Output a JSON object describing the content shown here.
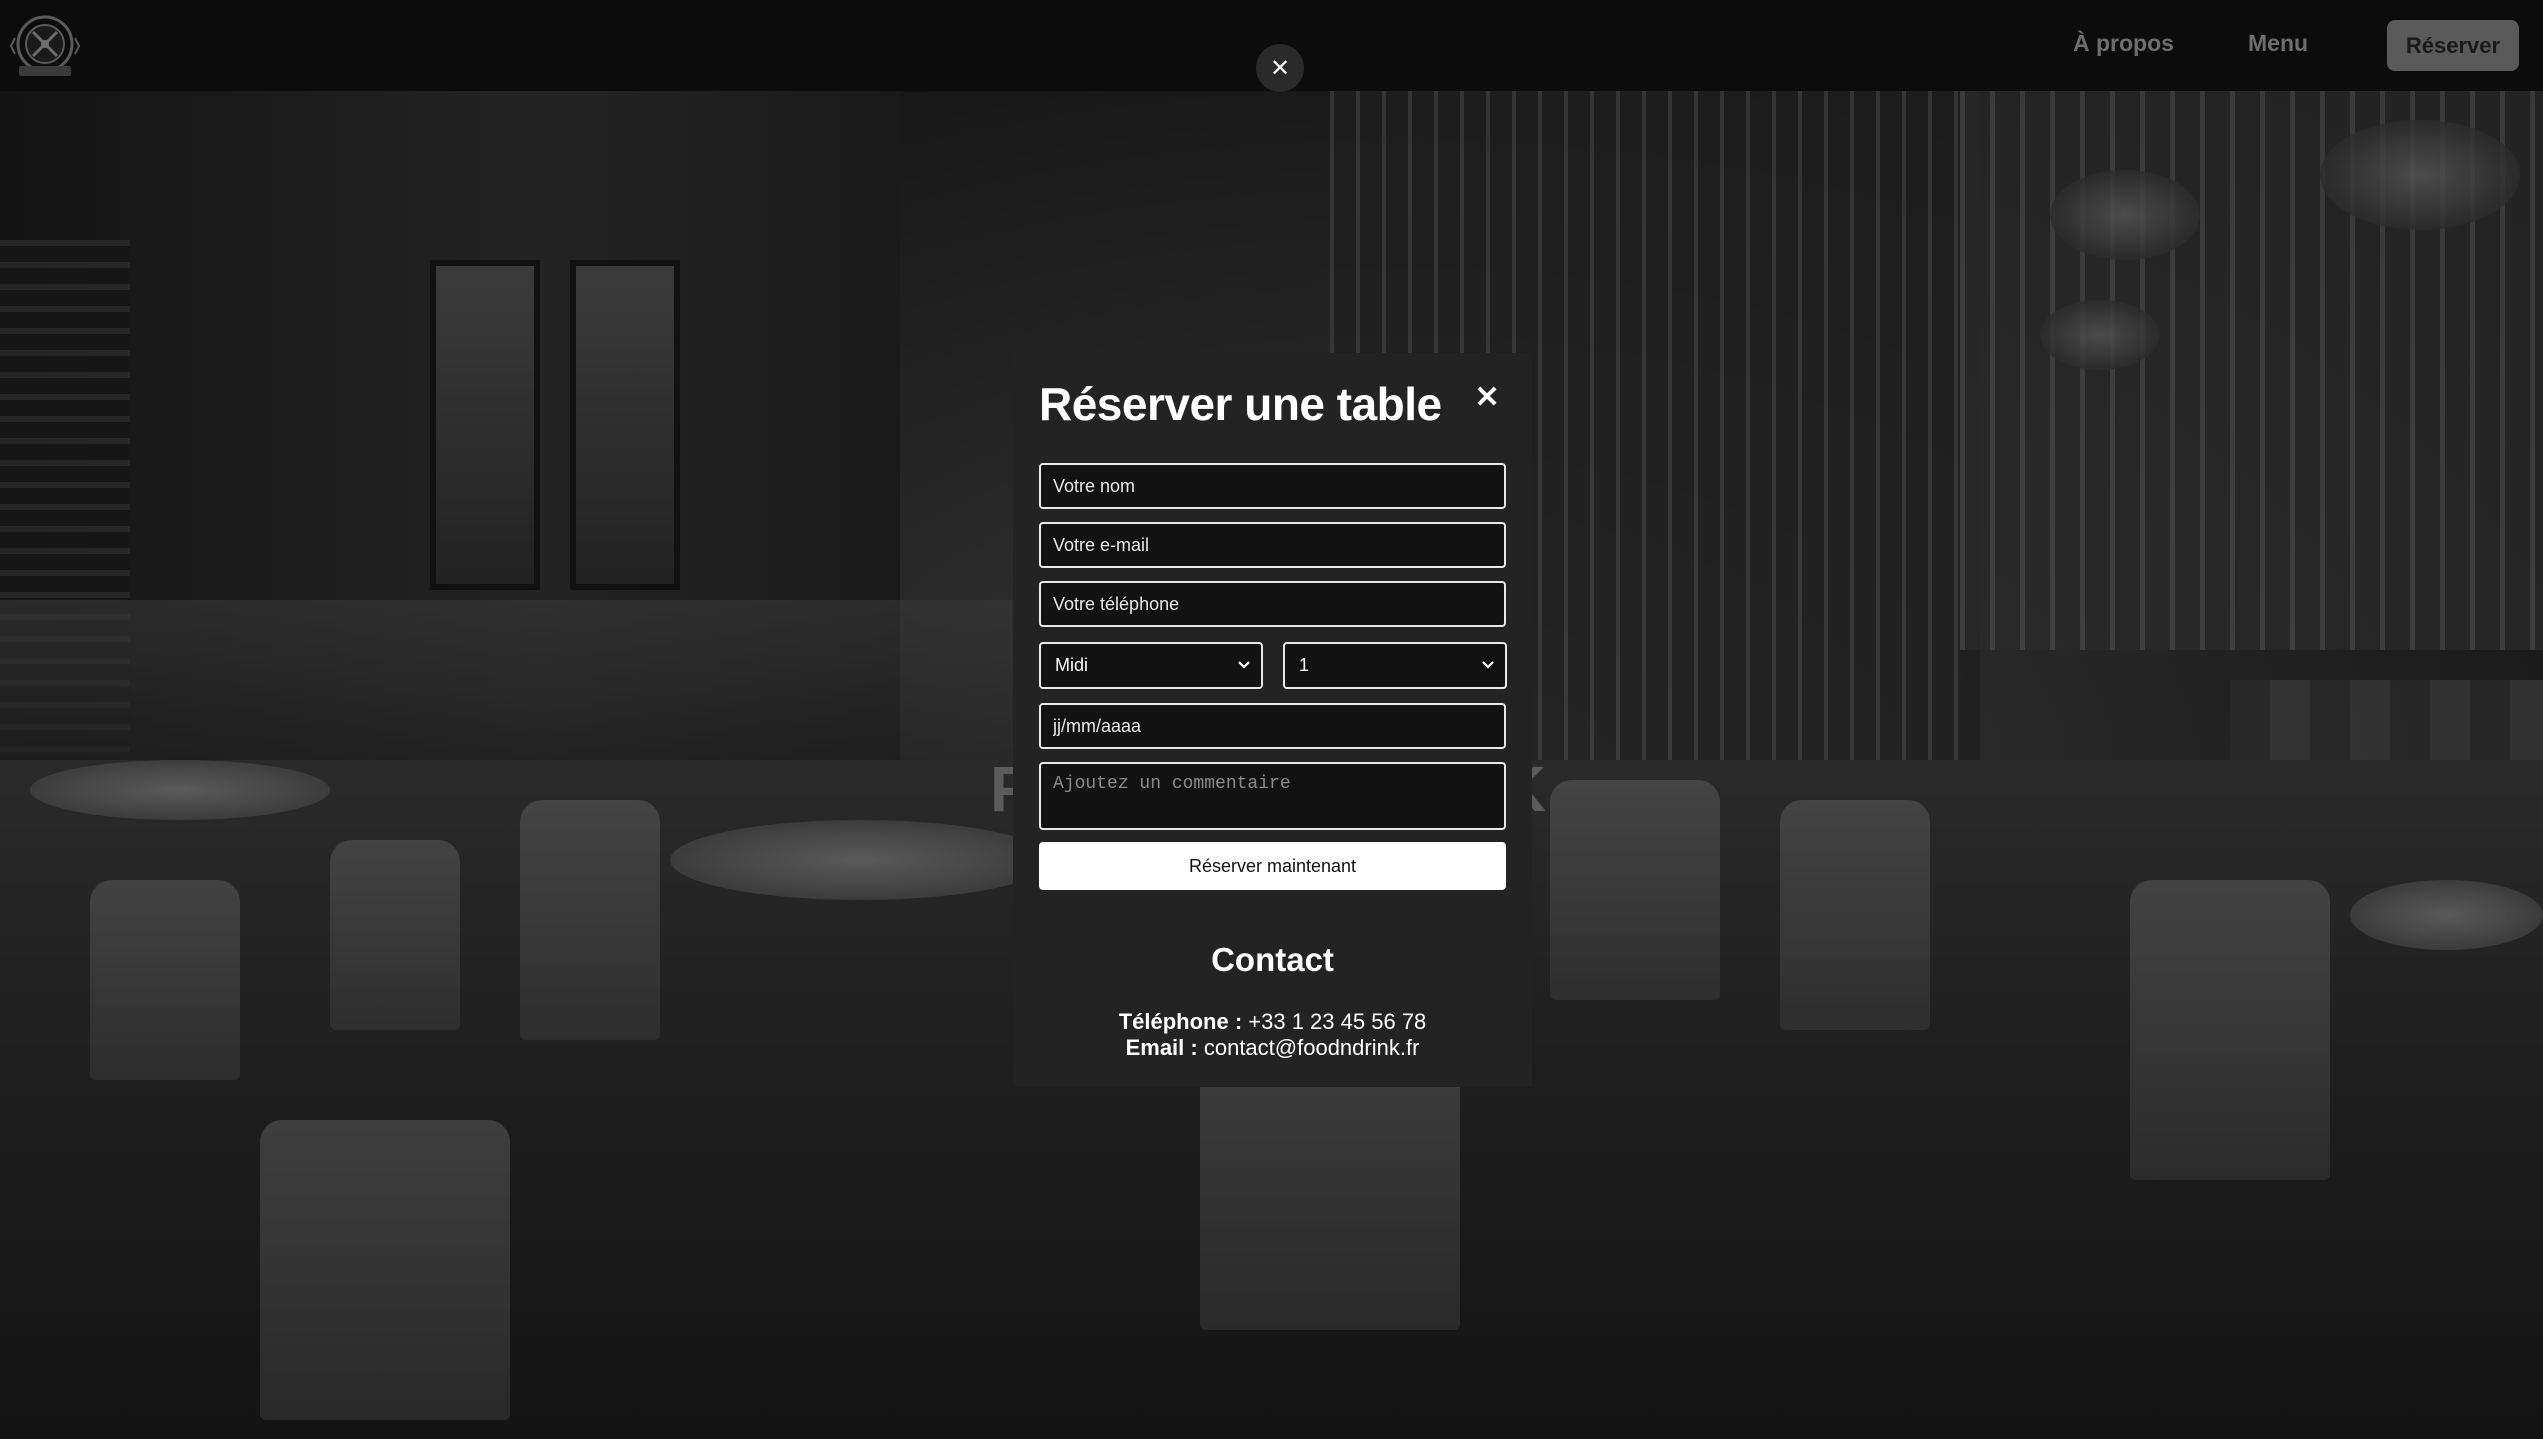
{
  "nav": {
    "about_label": "À propos",
    "menu_label": "Menu",
    "reserve_label": "Réserver"
  },
  "overlay": {
    "close_glyph": "✕"
  },
  "hero": {
    "text_left": "F",
    "text_right": "K"
  },
  "modal": {
    "title": "Réserver une table",
    "close_glyph": "✕",
    "fields": {
      "name_placeholder": "Votre nom",
      "email_placeholder": "Votre e-mail",
      "phone_placeholder": "Votre téléphone",
      "service_selected": "Midi",
      "guests_selected": "1",
      "date_placeholder": "jj/mm/aaaa",
      "comment_placeholder": "Ajoutez un commentaire"
    },
    "submit_label": "Réserver maintenant",
    "contact": {
      "title": "Contact",
      "phone_label": "Téléphone :",
      "phone_value": "+33 1 23 45 56 78",
      "email_label": "Email :",
      "email_value": "contact@foodndrink.fr"
    }
  },
  "icons": {
    "logo": "crossed-utensils-logo-icon",
    "close": "close-icon",
    "chevron": "chevron-down-icon"
  },
  "colors": {
    "modal_bg": "#232323",
    "nav_button_bg": "#5a5a5a",
    "field_border": "#e8e8e8",
    "submit_bg": "#ffffff"
  }
}
